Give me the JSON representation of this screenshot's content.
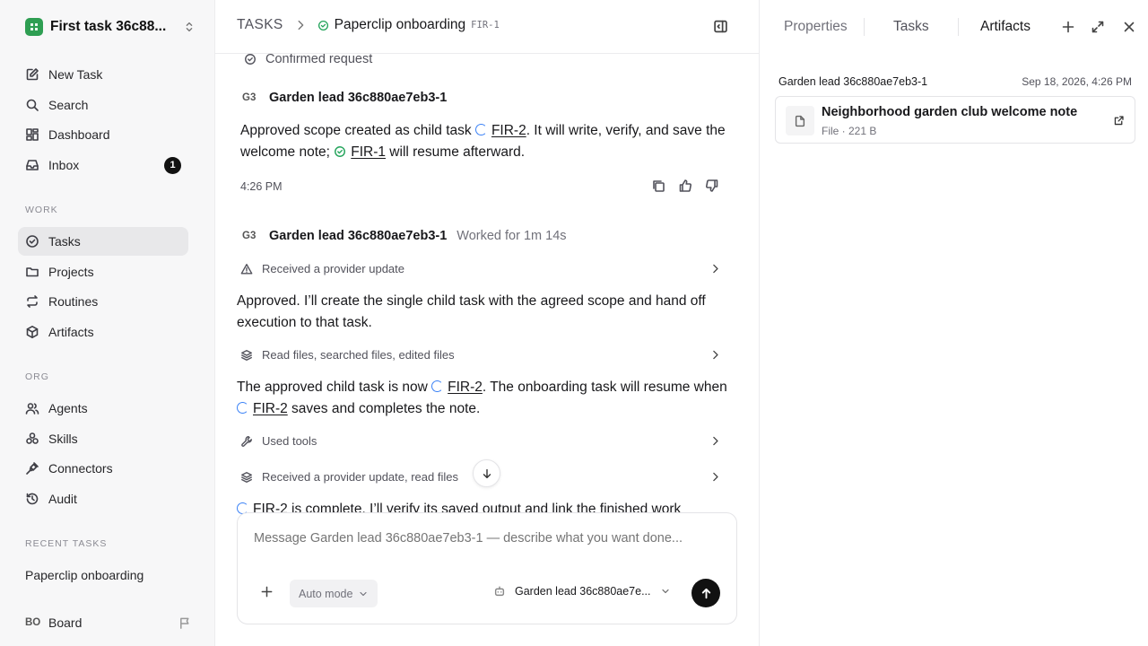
{
  "sidebar": {
    "workspace": "First task 36c88...",
    "nav": [
      "New Task",
      "Search",
      "Dashboard",
      "Inbox"
    ],
    "inbox_count": "1",
    "work_label": "WORK",
    "work_items": [
      "Tasks",
      "Projects",
      "Routines",
      "Artifacts"
    ],
    "org_label": "ORG",
    "org_items": [
      "Agents",
      "Skills",
      "Connectors",
      "Audit"
    ],
    "recent_label": "RECENT TASKS",
    "recent_item": "Paperclip onboarding",
    "board_initials": "BO",
    "board_label": "Board"
  },
  "header": {
    "section": "TASKS",
    "task_title": "Paperclip onboarding",
    "task_code": "FIR-1"
  },
  "feed": {
    "confirmed": "Confirmed request",
    "msg1": {
      "avatar": "G3",
      "author": "Garden lead 36c880ae7eb3-1",
      "a": "Approved scope created as child task ",
      "link1": "FIR-2",
      "b": ". It will write, verify, and save the welcome note; ",
      "link2": "FIR-1",
      "c": " will resume afterward.",
      "time": "4:26 PM"
    },
    "msg2": {
      "avatar": "G3",
      "author": "Garden lead 36c880ae7eb3-1",
      "worked": "Worked for 1m 14s"
    },
    "act1": "Received a provider update",
    "text1": "Approved. I’ll create the single child task with the agreed scope and hand off execution to that task.",
    "act2": "Read files, searched files, edited files",
    "text2": {
      "a": "The approved child task is now ",
      "link1": "FIR-2",
      "b": ". The onboarding task will resume when ",
      "link2": "FIR-2",
      "c": " saves and completes the note."
    },
    "act3": "Used tools",
    "act4": "Received a provider update, read files",
    "text3": "FIR-2 is complete. I’ll verify its saved output and link the finished work"
  },
  "composer": {
    "placeholder": "Message Garden lead 36c880ae7eb3-1 — describe what you want done...",
    "mode": "Auto mode",
    "agent": "Garden lead 36c880ae7e..."
  },
  "panel": {
    "tabs": [
      "Properties",
      "Tasks",
      "Artifacts"
    ],
    "active_tab": "Artifacts",
    "artifact_author": "Garden lead 36c880ae7eb3-1",
    "artifact_date": "Sep 18, 2026, 4:26 PM",
    "artifact_name": "Neighborhood garden club welcome note",
    "artifact_meta": "File · 221 B"
  },
  "colors": {
    "accent_green": "#22a35a",
    "spinner_blue": "#3b82f6",
    "sidebar_bg": "#f7f7f8"
  }
}
